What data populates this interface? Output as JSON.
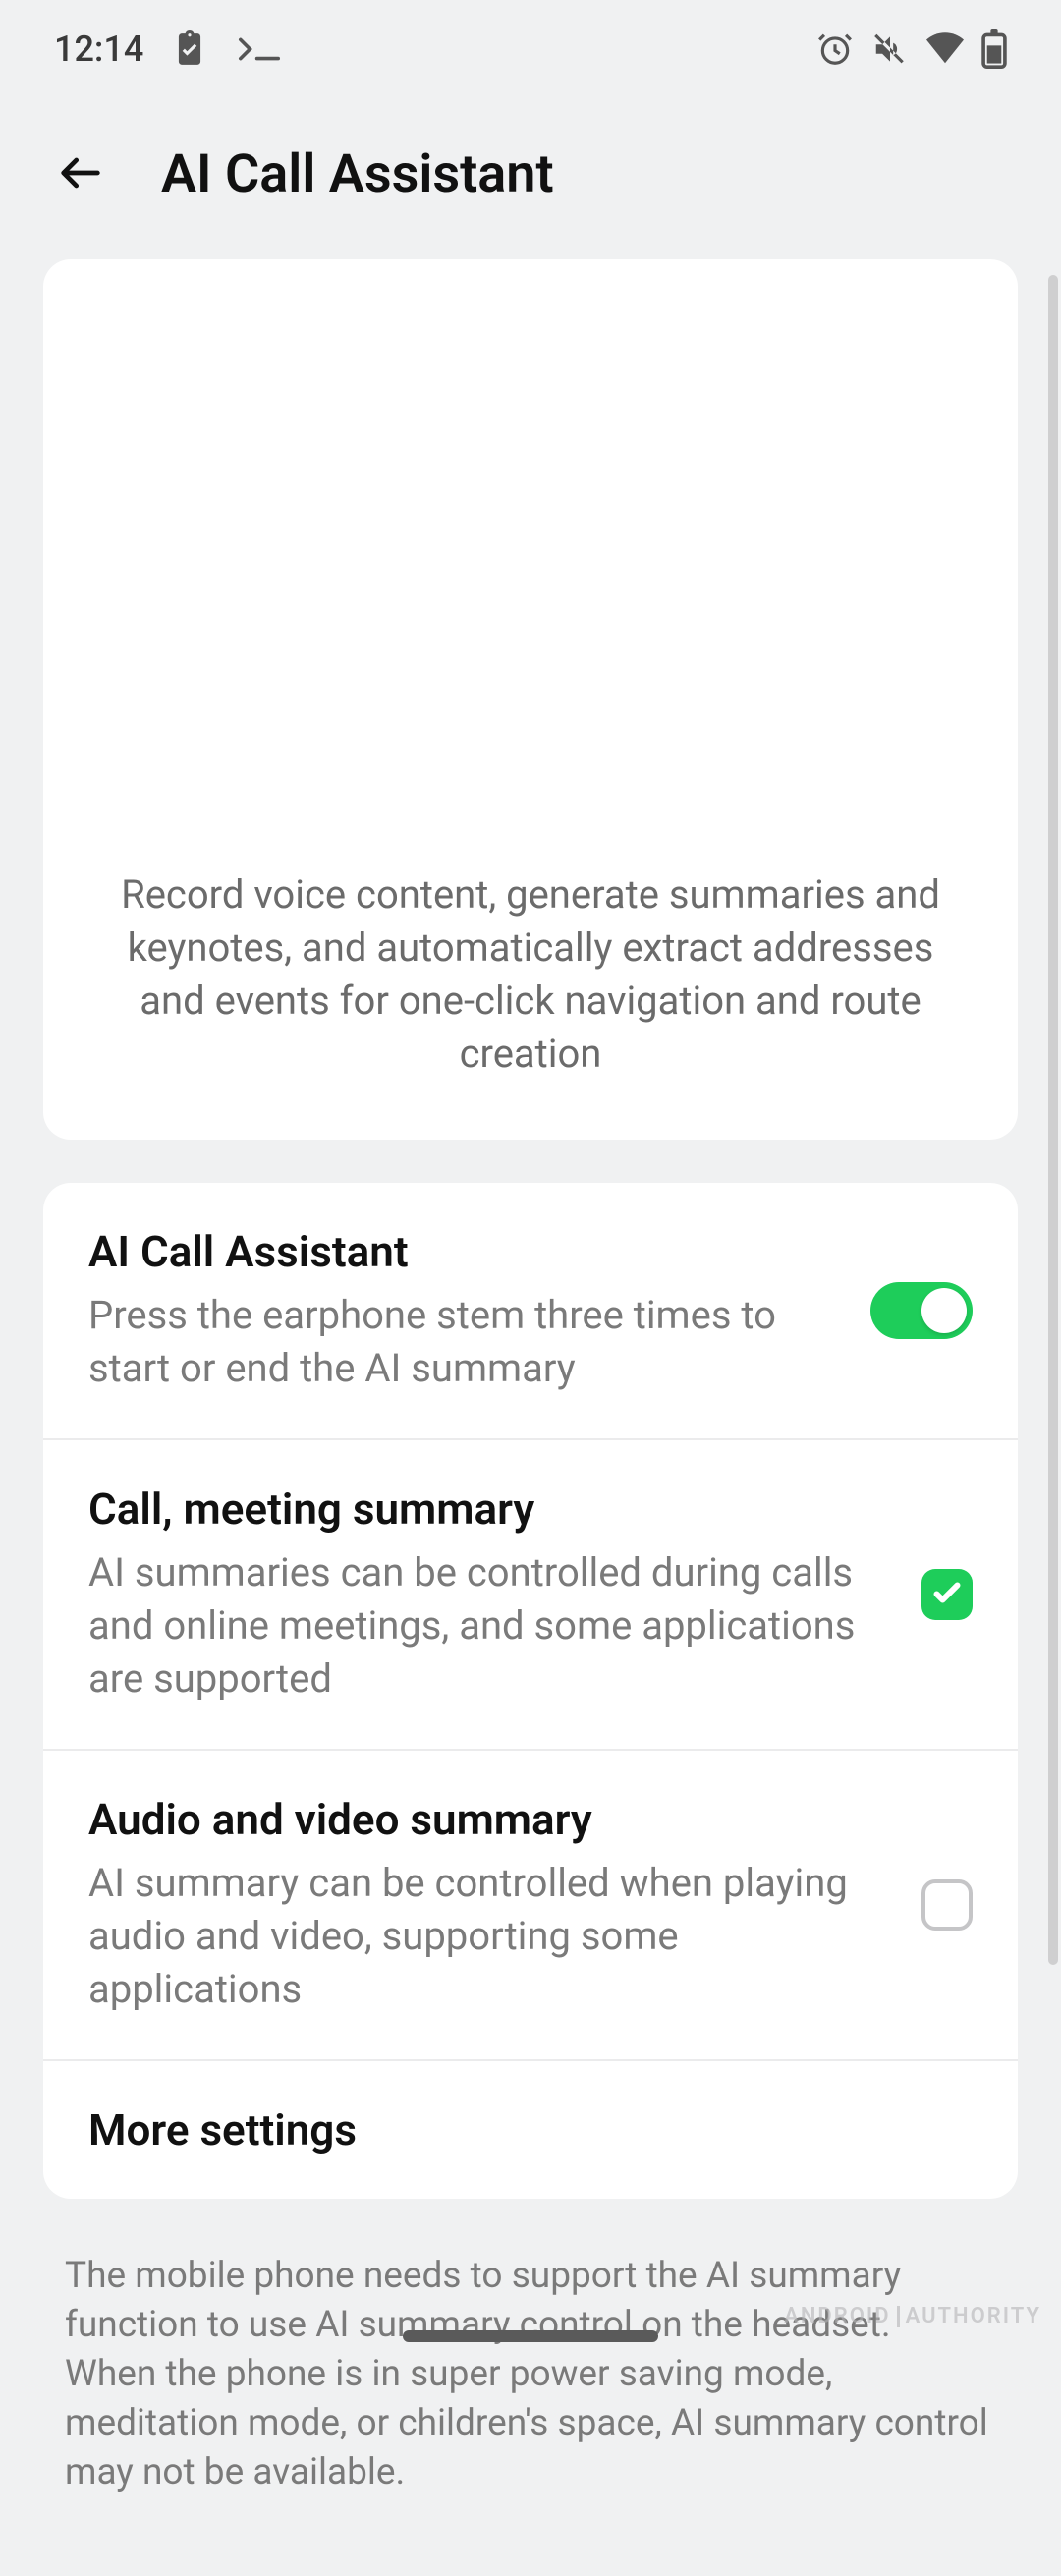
{
  "status": {
    "time": "12:14"
  },
  "header": {
    "title": "AI Call Assistant"
  },
  "intro": {
    "text": "Record voice content, generate summaries and keynotes, and automatically extract addresses and events for one-click navigation and route creation"
  },
  "settings": [
    {
      "title": "AI Call Assistant",
      "desc": "Press the earphone stem three times to start or end the AI summary",
      "control": "toggle",
      "state": true
    },
    {
      "title": "Call, meeting summary",
      "desc": "AI summaries can be controlled during calls and online meetings, and some applications are supported",
      "control": "checkbox",
      "state": true
    },
    {
      "title": "Audio and video summary",
      "desc": "AI summary can be controlled when playing audio and video, supporting some applications",
      "control": "checkbox",
      "state": false
    },
    {
      "title": "More settings",
      "desc": "",
      "control": "nav"
    }
  ],
  "footer": {
    "text": "The mobile phone needs to support the AI summary function to use AI summary control on the headset.\nWhen the phone is in super power saving mode, meditation mode, or children's space, AI summary control may not be available."
  },
  "watermark": {
    "left": "ANDROID",
    "right": "AUTHORITY"
  }
}
